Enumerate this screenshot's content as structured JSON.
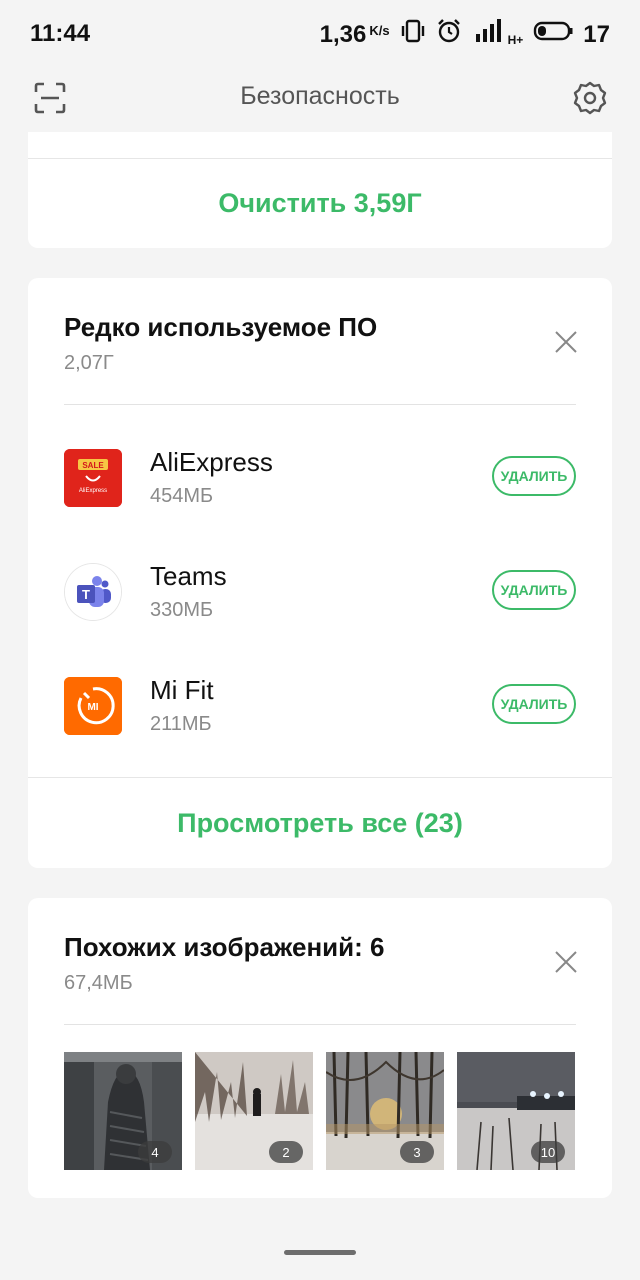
{
  "status_bar": {
    "time": "11:44",
    "speed": "1,36",
    "speed_unit": "K/s",
    "network_type": "H+",
    "battery": "17"
  },
  "header": {
    "title": "Безопасность",
    "left_icon": "scan-icon",
    "right_icon": "gear-icon"
  },
  "top_card": {
    "action_label": "Очистить 3,59Г"
  },
  "rare_apps": {
    "title": "Редко используемое ПО",
    "size": "2,07Г",
    "apps": [
      {
        "name": "AliExpress",
        "size": "454МБ",
        "button": "УДАЛИТЬ",
        "icon_text": "SALE",
        "icon_subtext": "AliExpress"
      },
      {
        "name": "Teams",
        "size": "330МБ",
        "button": "УДАЛИТЬ",
        "icon_text": "T"
      },
      {
        "name": "Mi Fit",
        "size": "211МБ",
        "button": "УДАЛИТЬ",
        "icon_text": "MI"
      }
    ],
    "view_all": "Просмотреть все (23)"
  },
  "similar_images": {
    "title": "Похожих изображений: 6",
    "size": "67,4МБ",
    "thumbnails": [
      {
        "badge": "4"
      },
      {
        "badge": "2"
      },
      {
        "badge": "3"
      },
      {
        "badge": "10"
      }
    ]
  },
  "colors": {
    "accent_green": "#3cba68",
    "background": "#f4f4f4"
  }
}
